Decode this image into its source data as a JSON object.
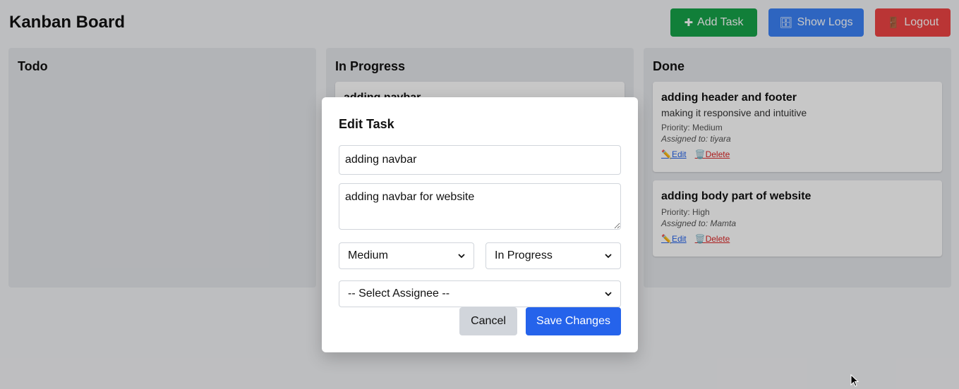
{
  "header": {
    "title": "Kanban Board",
    "add_task": "Add Task",
    "show_logs": "Show Logs",
    "logout": "Logout",
    "add_icon": "✚",
    "logs_icon": "🗄",
    "logout_icon": "🚪"
  },
  "columns": {
    "todo": {
      "title": "Todo"
    },
    "in_progress": {
      "title": "In Progress",
      "cards": [
        {
          "title": "adding navbar"
        }
      ]
    },
    "done": {
      "title": "Done",
      "cards": [
        {
          "title": "adding header and footer",
          "description": "making it responsive and intuitive",
          "priority": "Priority: Medium",
          "assigned": "Assigned to: tiyara",
          "edit": "Edit",
          "delete": "Delete"
        },
        {
          "title": "adding body part of website",
          "priority": "Priority: High",
          "assigned": "Assigned to: Mamta",
          "edit": "Edit",
          "delete": "Delete"
        }
      ]
    }
  },
  "icons": {
    "edit": "✏️",
    "delete": "🗑️"
  },
  "modal": {
    "title": "Edit Task",
    "task_title_value": "adding navbar",
    "task_description_value": "adding navbar for website",
    "priority_value": "Medium",
    "status_value": "In Progress",
    "assignee_value": "-- Select Assignee --",
    "cancel": "Cancel",
    "save": "Save Changes"
  },
  "colors": {
    "add": "#16a34a",
    "logs": "#3b82f6",
    "logout": "#ef4444",
    "save": "#2563eb",
    "cancel": "#d1d5db"
  }
}
